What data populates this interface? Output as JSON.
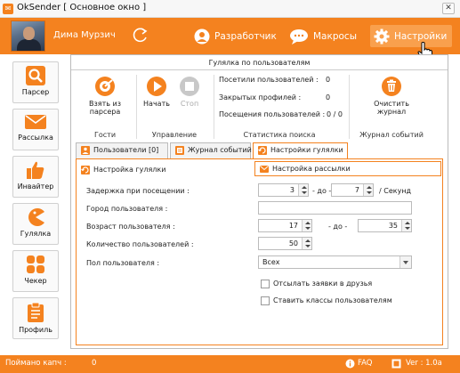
{
  "window": {
    "title": "OkSender [ Основное окно ]",
    "icon": "app-logo-icon",
    "close": "✕"
  },
  "header": {
    "user_name": "Дима Мурзич",
    "nav": [
      {
        "label": "Разработчик",
        "icon": "user-icon"
      },
      {
        "label": "Макросы",
        "icon": "chat-icon"
      },
      {
        "label": "Настройки",
        "icon": "gear-icon"
      }
    ]
  },
  "sidebar": {
    "items": [
      {
        "label": "Парсер",
        "icon": "search-icon"
      },
      {
        "label": "Рассылка",
        "icon": "mail-icon"
      },
      {
        "label": "Инвайтер",
        "icon": "thumbs-up-icon"
      },
      {
        "label": "Гулялка",
        "icon": "pacman-icon"
      },
      {
        "label": "Чекер",
        "icon": "grid-icon"
      },
      {
        "label": "Профиль",
        "icon": "clipboard-icon"
      }
    ]
  },
  "main": {
    "title": "Гулялка по пользователям",
    "groups": {
      "guests": "Гости",
      "control": "Управление",
      "stats": "Статистика поиска",
      "log": "Журнал событий"
    },
    "buttons": {
      "take_from_parser": "Взять из\nпарсера",
      "start": "Начать",
      "stop": "Стоп",
      "clear_log": "Очистить\nжурнал"
    },
    "stats": [
      {
        "label": "Посетили пользователей :",
        "value": "0"
      },
      {
        "label": "Закрытых профилей :",
        "value": "0"
      },
      {
        "label": "Посещения пользователей :",
        "value": "0 / 0"
      }
    ],
    "tabs": [
      {
        "label": "Пользователи [0]"
      },
      {
        "label": "Журнал событий"
      },
      {
        "label": "Настройки гулялки"
      }
    ],
    "subtabs": [
      {
        "label": "Настройка гулялки"
      },
      {
        "label": "Настройка рассылки"
      }
    ],
    "form": {
      "delay_label": "Задержка при посещении :",
      "delay_from": "3",
      "delay_sep": "- до -",
      "delay_to": "7",
      "delay_unit": "/ Секунд",
      "city_label": "Город пользователя :",
      "age_label": "Возраст пользователя :",
      "age_from": "17",
      "age_sep": "- до -",
      "age_to": "35",
      "count_label": "Количество пользователей :",
      "count_value": "50",
      "gender_label": "Пол пользователя :",
      "gender_value": "Всех",
      "cb_friends": "Отсылать заявки в друзья",
      "cb_classes": "Ставить классы пользователям"
    }
  },
  "statusbar": {
    "captcha_label": "Поймано капч :",
    "captcha_value": "0",
    "faq": "FAQ",
    "version": "Ver : 1.0a"
  },
  "colors": {
    "accent": "#f4821f",
    "accent_light": "#f9a04d"
  }
}
